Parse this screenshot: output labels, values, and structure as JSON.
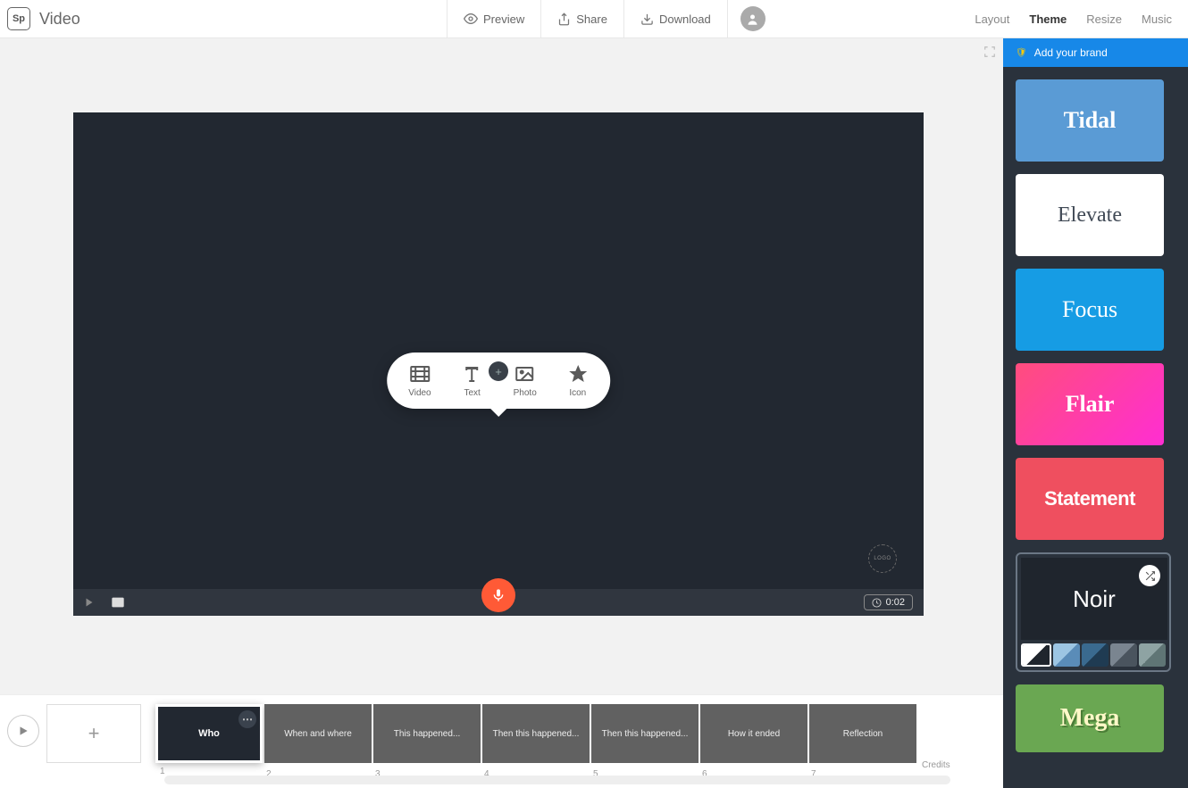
{
  "header": {
    "logo_text": "Sp",
    "title": "Video",
    "preview": "Preview",
    "share": "Share",
    "download": "Download",
    "nav": {
      "layout": "Layout",
      "theme": "Theme",
      "resize": "Resize",
      "music": "Music"
    }
  },
  "canvas": {
    "add_options": {
      "video": "Video",
      "text": "Text",
      "photo": "Photo",
      "icon": "Icon"
    },
    "logo_badge": "LOGO",
    "time": "0:02"
  },
  "timeline": {
    "slides": [
      {
        "label": "Who",
        "num": "1",
        "active": true
      },
      {
        "label": "When and where",
        "num": "2"
      },
      {
        "label": "This happened...",
        "num": "3"
      },
      {
        "label": "Then this happened...",
        "num": "4"
      },
      {
        "label": "Then this happened...",
        "num": "5"
      },
      {
        "label": "How it ended",
        "num": "6"
      },
      {
        "label": "Reflection",
        "num": "7"
      }
    ],
    "credits": "Credits"
  },
  "sidebar": {
    "brand": "Add your brand",
    "themes": {
      "tidal": "Tidal",
      "elevate": "Elevate",
      "focus": "Focus",
      "flair": "Flair",
      "statement": "Statement",
      "noir": "Noir",
      "mega": "Mega"
    },
    "noir_palette": [
      {
        "c1": "#ffffff",
        "c2": "#1f252d",
        "selected": true
      },
      {
        "c1": "#9cc5e3",
        "c2": "#5a8cb8"
      },
      {
        "c1": "#3a6a8f",
        "c2": "#1f3b52"
      },
      {
        "c1": "#7a8590",
        "c2": "#4a545e"
      },
      {
        "c1": "#8ea3a3",
        "c2": "#5f7575"
      }
    ]
  }
}
